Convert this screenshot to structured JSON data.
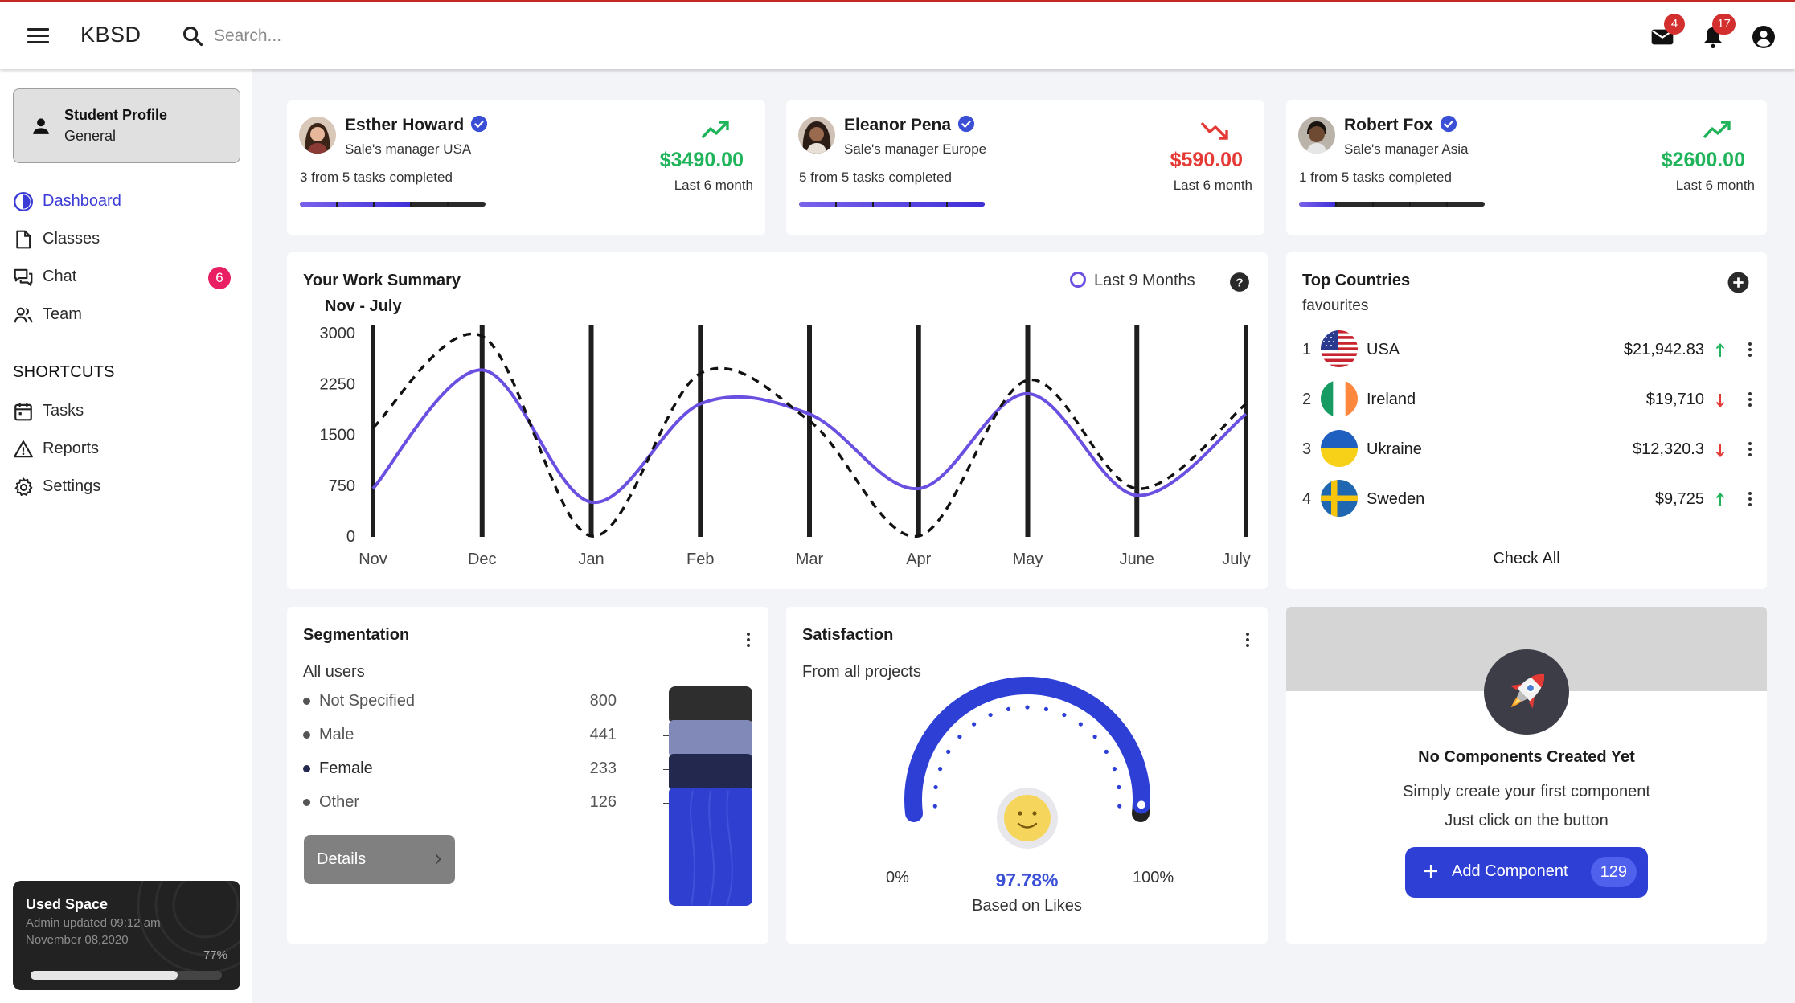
{
  "header": {
    "brand": "KBSD",
    "search_placeholder": "Search...",
    "mail_badge": "4",
    "notifications_badge": "17"
  },
  "sidebar": {
    "profile": {
      "title": "Student Profile",
      "subtitle": "General"
    },
    "nav": [
      {
        "label": "Dashboard",
        "icon": "dashboard-icon",
        "active": true
      },
      {
        "label": "Classes",
        "icon": "document-icon"
      },
      {
        "label": "Chat",
        "icon": "chat-icon",
        "badge": "6"
      },
      {
        "label": "Team",
        "icon": "team-icon"
      }
    ],
    "shortcuts_title": "SHORTCUTS",
    "shortcuts": [
      {
        "label": "Tasks",
        "icon": "calendar-icon"
      },
      {
        "label": "Reports",
        "icon": "warning-icon"
      },
      {
        "label": "Settings",
        "icon": "gear-icon"
      }
    ],
    "used_space": {
      "title": "Used Space",
      "line1": "Admin updated 09:12 am",
      "line2": "November 08,2020",
      "percent_label": "77%",
      "fill": 0.77
    }
  },
  "people": [
    {
      "name": "Esther Howard",
      "role": "Sale's manager USA",
      "tasks": "3 from 5 tasks completed",
      "amount": "$3490.00",
      "period": "Last 6 month",
      "trend": "up",
      "progress": 0.6
    },
    {
      "name": "Eleanor Pena",
      "role": "Sale's manager Europe",
      "tasks": "5 from 5 tasks completed",
      "amount": "$590.00",
      "period": "Last 6 month",
      "trend": "down",
      "progress": 1.0
    },
    {
      "name": "Robert Fox",
      "role": "Sale's manager Asia",
      "tasks": "1 from 5 tasks completed",
      "amount": "$2600.00",
      "period": "Last 6 month",
      "trend": "up",
      "progress": 0.2
    }
  ],
  "colors": {
    "up": "#1fb35a",
    "down": "#e53935",
    "accent": "#2e3fd6",
    "series_line": "#6a4fe0"
  },
  "work_summary": {
    "title": "Your Work Summary",
    "subtitle": "Nov - July",
    "range_label": "Last 9 Months"
  },
  "chart_data": {
    "type": "line",
    "categories": [
      "Nov",
      "Dec",
      "Jan",
      "Feb",
      "Mar",
      "Apr",
      "May",
      "June",
      "July"
    ],
    "y_ticks": [
      "3000",
      "2250",
      "1500",
      "750",
      "0"
    ],
    "ylim": [
      0,
      3000
    ],
    "series": [
      {
        "style": "solid",
        "color": "#6a4fe0",
        "values": [
          700,
          2450,
          500,
          1950,
          1800,
          700,
          2100,
          600,
          1800
        ]
      },
      {
        "style": "dashed",
        "color": "#111111",
        "values": [
          1600,
          2950,
          0,
          2400,
          1700,
          0,
          2300,
          700,
          1950
        ]
      }
    ]
  },
  "top_countries": {
    "title": "Top Countries",
    "subtitle": "favourites",
    "rows": [
      {
        "rank": "1",
        "name": "USA",
        "amount": "$21,942.83",
        "trend": "up",
        "flag": "usa-flag"
      },
      {
        "rank": "2",
        "name": "Ireland",
        "amount": "$19,710",
        "trend": "down",
        "flag": "ireland-flag"
      },
      {
        "rank": "3",
        "name": "Ukraine",
        "amount": "$12,320.3",
        "trend": "down",
        "flag": "ukraine-flag"
      },
      {
        "rank": "4",
        "name": "Sweden",
        "amount": "$9,725",
        "trend": "up",
        "flag": "sweden-flag"
      }
    ],
    "check_all": "Check All"
  },
  "segmentation": {
    "title": "Segmentation",
    "subtitle": "All users",
    "rows": [
      {
        "label": "Not Specified",
        "value": "800",
        "color": "#2e2e2e"
      },
      {
        "label": "Male",
        "value": "441",
        "color": "#8089b8"
      },
      {
        "label": "Female",
        "value": "233",
        "color": "#23284f"
      },
      {
        "label": "Other",
        "value": "126",
        "color": "#2f3fd0"
      }
    ],
    "details_label": "Details"
  },
  "satisfaction": {
    "title": "Satisfaction",
    "subtitle": "From all projects",
    "min_label": "0%",
    "max_label": "100%",
    "value_label": "97.78%",
    "value": 97.78,
    "note": "Based on Likes"
  },
  "components": {
    "title": "No Components Created Yet",
    "line1": "Simply create your first component",
    "line2": "Just click on the button",
    "button_label": "Add Component",
    "count": "129"
  }
}
